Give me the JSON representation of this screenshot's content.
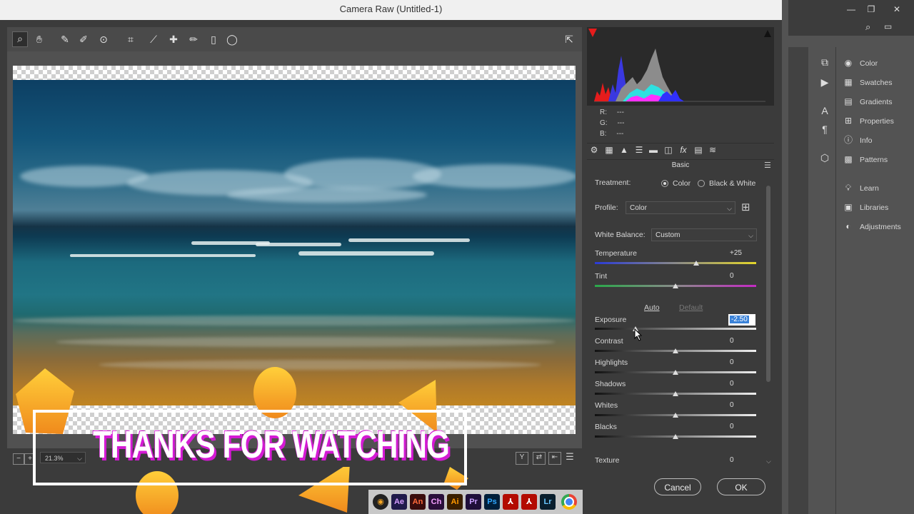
{
  "dialog": {
    "title": "Camera Raw (Untitled-1)"
  },
  "photoshop_panel": {
    "items": [
      {
        "label": "Color",
        "icon": "color-wheel-icon"
      },
      {
        "label": "Swatches",
        "icon": "swatches-grid-icon"
      },
      {
        "label": "Gradients",
        "icon": "gradients-icon"
      },
      {
        "label": "Properties",
        "icon": "properties-icon"
      },
      {
        "label": "Info",
        "icon": "info-icon"
      },
      {
        "label": "Patterns",
        "icon": "patterns-icon"
      },
      {
        "label": "Learn",
        "icon": "lightbulb-icon"
      },
      {
        "label": "Libraries",
        "icon": "libraries-icon"
      },
      {
        "label": "Adjustments",
        "icon": "adjustments-icon"
      }
    ]
  },
  "rgb_readout": {
    "r_label": "R:",
    "g_label": "G:",
    "b_label": "B:",
    "r": "---",
    "g": "---",
    "b": "---"
  },
  "basic_panel": {
    "title": "Basic",
    "treatment_label": "Treatment:",
    "treatment_options": [
      "Color",
      "Black & White"
    ],
    "treatment_selected": "Color",
    "profile_label": "Profile:",
    "profile_value": "Color",
    "white_balance_label": "White Balance:",
    "white_balance_value": "Custom",
    "auto_label": "Auto",
    "default_label": "Default",
    "sliders": [
      {
        "label": "Temperature",
        "value": "+25",
        "level": 0.63
      },
      {
        "label": "Tint",
        "value": "0",
        "level": 0.5
      },
      {
        "label": "Exposure",
        "value": "-2.50",
        "level": 0.25
      },
      {
        "label": "Contrast",
        "value": "0",
        "level": 0.5
      },
      {
        "label": "Highlights",
        "value": "0",
        "level": 0.5
      },
      {
        "label": "Shadows",
        "value": "0",
        "level": 0.5
      },
      {
        "label": "Whites",
        "value": "0",
        "level": 0.5
      },
      {
        "label": "Blacks",
        "value": "0",
        "level": 0.5
      },
      {
        "label": "Texture",
        "value": "0",
        "level": 0.5
      }
    ]
  },
  "status": {
    "zoom": "21.3%"
  },
  "buttons": {
    "cancel": "Cancel",
    "ok": "OK"
  },
  "overlay": {
    "thanks_text": "THANKS FOR WATCHING"
  },
  "taskbar": {
    "apps": [
      "Ae",
      "An",
      "Ch",
      "Ai",
      "Pr",
      "Ps",
      "Lr"
    ]
  },
  "colors": {
    "accent_orange": "#f5a623",
    "magenta": "#d41ad4",
    "highlight_blue": "#3a82d8"
  }
}
